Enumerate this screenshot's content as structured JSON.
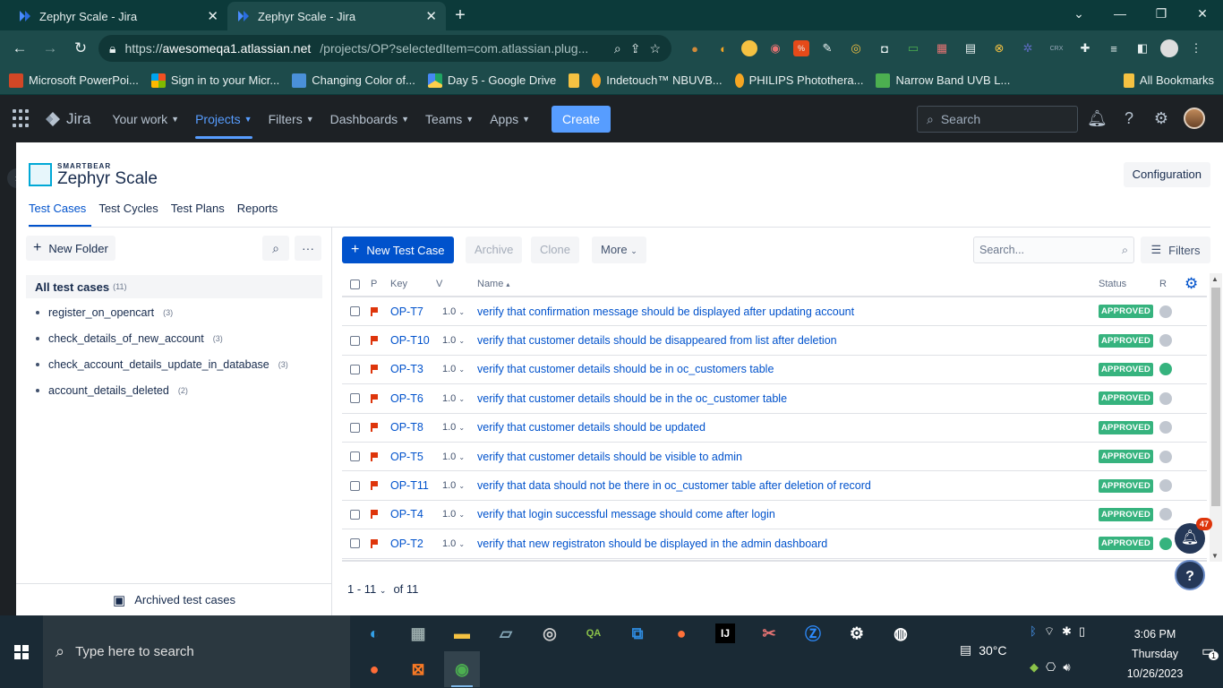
{
  "browser": {
    "tabs": [
      {
        "title": "Zephyr Scale - Jira",
        "active": false
      },
      {
        "title": "Zephyr Scale - Jira",
        "active": true
      }
    ],
    "url_prefix": "https://",
    "url_host": "awesomeqa1.atlassian.net",
    "url_tail": "/projects/OP?selectedItem=com.atlassian.plug...",
    "bookmarks": [
      {
        "label": "Microsoft PowerPoi...",
        "color": "#d24726"
      },
      {
        "label": "Sign in to your Micr...",
        "color": "#f25022"
      },
      {
        "label": "Changing Color of...",
        "color": "#4a90d9"
      },
      {
        "label": "Day 5 - Google Drive",
        "color": "#1fa463"
      },
      {
        "label": "",
        "color": "#f5c242"
      },
      {
        "label": "Indetouch™ NBUVB...",
        "color": "#f5a623"
      },
      {
        "label": "PHILIPS Phototherа...",
        "color": "#f5a623"
      },
      {
        "label": "Narrow Band UVB L...",
        "color": "#4caf50"
      }
    ],
    "all_bookmarks": "All Bookmarks"
  },
  "jira": {
    "logo": "Jira",
    "nav": [
      {
        "label": "Your work",
        "active": false
      },
      {
        "label": "Projects",
        "active": true
      },
      {
        "label": "Filters",
        "active": false
      },
      {
        "label": "Dashboards",
        "active": false
      },
      {
        "label": "Teams",
        "active": false
      },
      {
        "label": "Apps",
        "active": false
      }
    ],
    "create": "Create",
    "search_placeholder": "Search"
  },
  "zephyr": {
    "brand_small": "SMARTBEAR",
    "brand_big": "Zephyr Scale",
    "configuration": "Configuration",
    "tabs": [
      {
        "label": "Test Cases",
        "active": true
      },
      {
        "label": "Test Cycles",
        "active": false
      },
      {
        "label": "Test Plans",
        "active": false
      },
      {
        "label": "Reports",
        "active": false
      }
    ]
  },
  "folders": {
    "new_folder": "New Folder",
    "all_label": "All test cases",
    "all_count": "(11)",
    "items": [
      {
        "name": "register_on_opencart",
        "count": "(3)"
      },
      {
        "name": "check_details_of_new_account",
        "count": "(3)"
      },
      {
        "name": "check_account_details_update_in_database",
        "count": "(3)"
      },
      {
        "name": "account_details_deleted",
        "count": "(2)"
      }
    ],
    "archived": "Archived test cases"
  },
  "toolbar": {
    "new_test_case": "New Test Case",
    "archive": "Archive",
    "clone": "Clone",
    "more": "More",
    "search_placeholder": "Search...",
    "filters": "Filters"
  },
  "table": {
    "headers": {
      "p": "P",
      "key": "Key",
      "v": "V",
      "name": "Name",
      "status": "Status",
      "r": "R"
    },
    "rows": [
      {
        "key": "OP-T7",
        "version": "1.0",
        "name": "verify that confirmation message should be displayed after updating account",
        "status": "APPROVED",
        "r_color": "#c1c7d0"
      },
      {
        "key": "OP-T10",
        "version": "1.0",
        "name": "verify that customer details should be disappeared from list after deletion",
        "status": "APPROVED",
        "r_color": "#c1c7d0"
      },
      {
        "key": "OP-T3",
        "version": "1.0",
        "name": "verify that customer details should be in oc_customers table",
        "status": "APPROVED",
        "r_color": "#36b37e"
      },
      {
        "key": "OP-T6",
        "version": "1.0",
        "name": "verify that customer details should be in the oc_customer table",
        "status": "APPROVED",
        "r_color": "#c1c7d0"
      },
      {
        "key": "OP-T8",
        "version": "1.0",
        "name": "verify that customer details should be updated",
        "status": "APPROVED",
        "r_color": "#c1c7d0"
      },
      {
        "key": "OP-T5",
        "version": "1.0",
        "name": "verify that customer details should be visible to admin",
        "status": "APPROVED",
        "r_color": "#c1c7d0"
      },
      {
        "key": "OP-T11",
        "version": "1.0",
        "name": "verify that data should not be there in oc_customer table after deletion of record",
        "status": "APPROVED",
        "r_color": "#c1c7d0"
      },
      {
        "key": "OP-T4",
        "version": "1.0",
        "name": "verify that login successful message should come after login",
        "status": "APPROVED",
        "r_color": "#c1c7d0"
      },
      {
        "key": "OP-T2",
        "version": "1.0",
        "name": "verify that new registraton should be displayed in the admin dashboard",
        "status": "APPROVED",
        "r_color": "#36b37e"
      }
    ]
  },
  "pager": {
    "range": "1 - 11",
    "of": "of 11"
  },
  "widgets": {
    "notif_count": "47"
  },
  "taskbar": {
    "search_placeholder": "Type here to search",
    "temperature": "30°C",
    "time": "3:06 PM",
    "day": "Thursday",
    "date": "10/26/2023",
    "action_count": "1"
  }
}
